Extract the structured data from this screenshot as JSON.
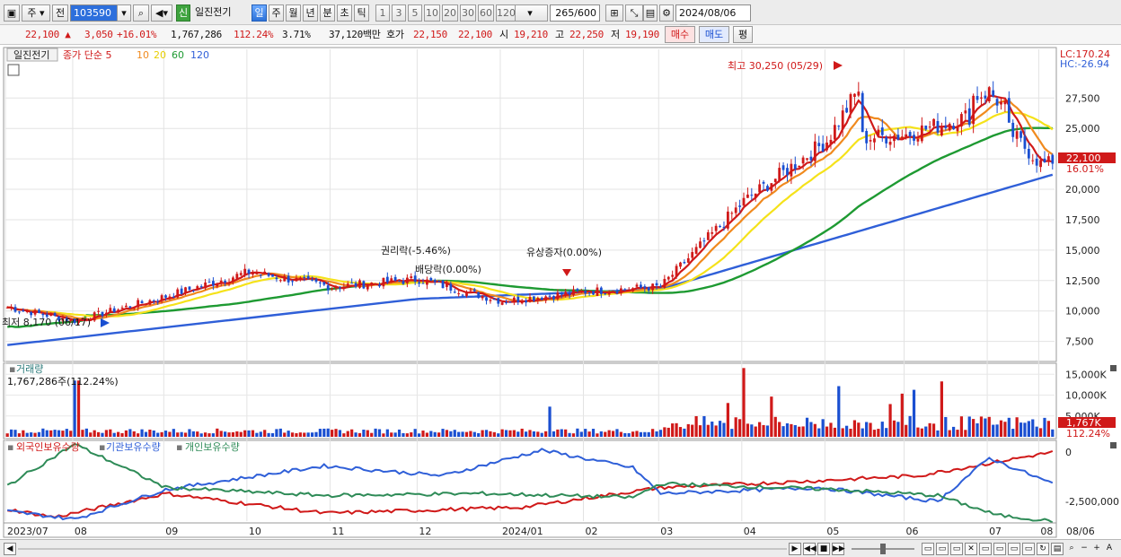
{
  "toolbar": {
    "market": "주",
    "prefix": "전",
    "code": "103590",
    "badge": "신",
    "stock_name": "일진전기",
    "periods": [
      "일",
      "주",
      "월",
      "년",
      "분",
      "초",
      "틱"
    ],
    "active_period": "일",
    "intervals": [
      "1",
      "3",
      "5",
      "10",
      "20",
      "30",
      "60",
      "120"
    ],
    "count": "265",
    "max_count": "/600",
    "date": "2024/08/06"
  },
  "quote": {
    "price": "22,100",
    "change": "3,050",
    "change_pct": "+16.01%",
    "volume": "1,767,286",
    "volume_ratio": "112.24%",
    "turnover": "3.71%",
    "amount": "37,120백만",
    "ask_label": "호가",
    "ask1": "22,150",
    "ask2": "22,100",
    "open_label": "시",
    "open": "19,210",
    "high_label": "고",
    "high": "22,250",
    "low_label": "저",
    "low": "19,190",
    "buy_button": "매수",
    "sell_button": "매도",
    "eval_button": "평"
  },
  "price_panel": {
    "stock_tag": "일진전기",
    "legend": [
      "종가 단순 5",
      "10",
      "20",
      "60",
      "120"
    ],
    "lc": "LC:170.24",
    "hc": "HC:-26.94",
    "current_price": "22,100",
    "current_pct": "16.01%",
    "annotations": {
      "high": "최고 30,250 (05/29)",
      "low": "최저 8,170 (06/17)",
      "rights": "권리락(-5.46%)",
      "dividend": "배당락(0.00%)",
      "capital": "유상증자(0.00%)"
    },
    "y_ticks": [
      "27,500",
      "25,000",
      "22,500",
      "20,000",
      "17,500",
      "15,000",
      "12,500",
      "10,000",
      "7,500"
    ]
  },
  "volume_panel": {
    "title": "거래량",
    "value": "1,767,286주(112.24%)",
    "y_ticks": [
      "15,000K",
      "10,000K",
      "5,000K"
    ],
    "current": "1,767K",
    "current_pct": "112.24%"
  },
  "holding_panel": {
    "legend": [
      "외국인보유수량",
      "기관보유수량",
      "개인보유수량"
    ],
    "y_ticks": [
      "0",
      "-2,500,000"
    ]
  },
  "x_axis": [
    "2023/07",
    "08",
    "09",
    "10",
    "11",
    "12",
    "2024/01",
    "02",
    "03",
    "04",
    "05",
    "06",
    "07",
    "08"
  ],
  "x_axis_end": "08/06",
  "colors": {
    "up": "#d01919",
    "down": "#1a4fd1",
    "ma5": "#d01919",
    "ma10": "#f08a1e",
    "ma20": "#f5e21a",
    "ma60": "#1e9a32",
    "ma120": "#2f5fd8",
    "foreign": "#d01919",
    "institution": "#2f5fd8",
    "individual": "#2e8b57"
  },
  "chart_data": {
    "type": "candlestick",
    "months": [
      "2023/07",
      "08",
      "09",
      "10",
      "11",
      "12",
      "2024/01",
      "02",
      "03",
      "04",
      "05",
      "06",
      "07",
      "08"
    ],
    "close_key_points": [
      {
        "x": "2023/07",
        "y": 10300
      },
      {
        "x": "08",
        "y": 9200
      },
      {
        "x": "09",
        "y": 11200
      },
      {
        "x": "10",
        "y": 13200
      },
      {
        "x": "11",
        "y": 12000
      },
      {
        "x": "12",
        "y": 12600
      },
      {
        "x": "2024/01",
        "y": 10800
      },
      {
        "x": "02",
        "y": 11600
      },
      {
        "x": "03",
        "y": 12000
      },
      {
        "x": "04",
        "y": 19000
      },
      {
        "x": "05",
        "y": 24000
      },
      {
        "x": "06",
        "y": 24500
      },
      {
        "x": "07",
        "y": 26500
      },
      {
        "x": "08",
        "y": 22100
      }
    ],
    "ma120_key_points": [
      {
        "x": "2023/07",
        "y": 7200
      },
      {
        "x": "12",
        "y": 11000
      },
      {
        "x": "03",
        "y": 11800
      },
      {
        "x": "08",
        "y": 21200
      }
    ],
    "price_ylim": [
      6000,
      31500
    ],
    "volume_ylim": [
      0,
      17000000
    ],
    "holding_ylim": [
      -3500000,
      500000
    ]
  }
}
